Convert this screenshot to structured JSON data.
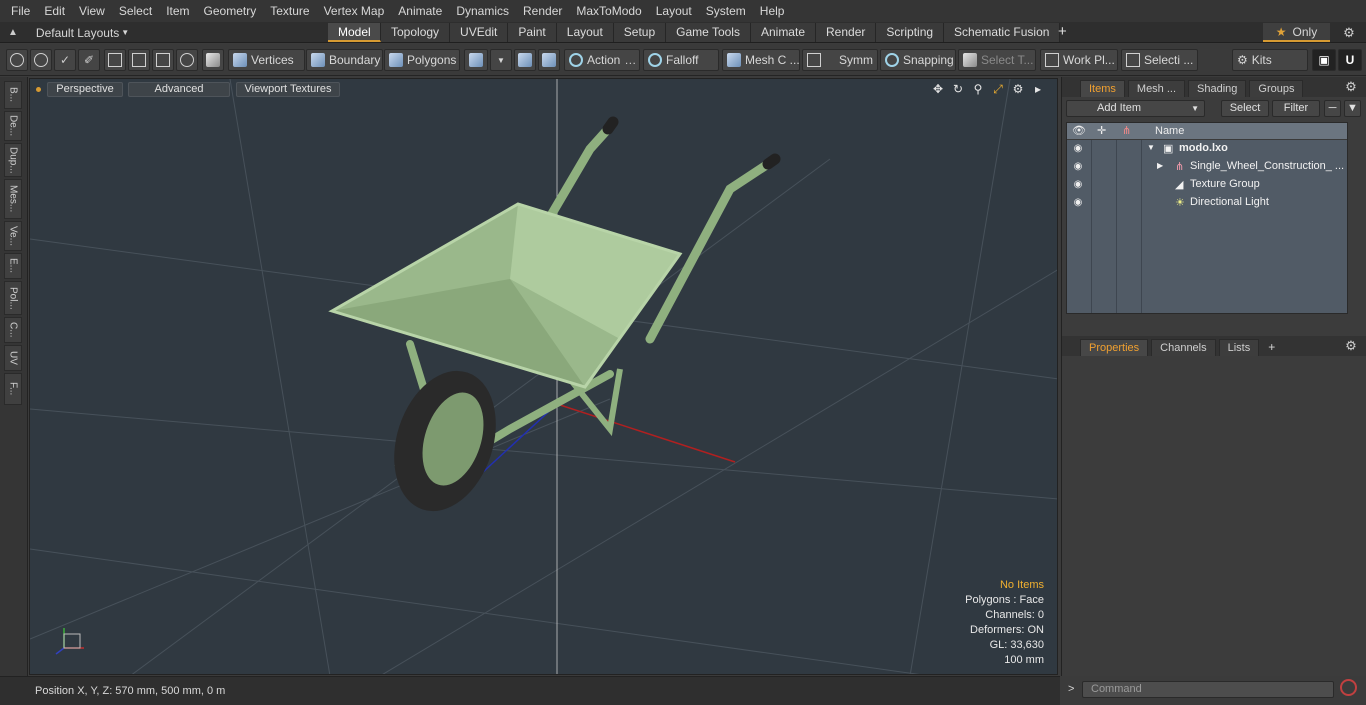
{
  "menu": [
    "File",
    "Edit",
    "View",
    "Select",
    "Item",
    "Geometry",
    "Texture",
    "Vertex Map",
    "Animate",
    "Dynamics",
    "Render",
    "MaxToModo",
    "Layout",
    "System",
    "Help"
  ],
  "layout_dropdown": "Default Layouts",
  "tabs": [
    "Model",
    "Topology",
    "UVEdit",
    "Paint",
    "Layout",
    "Setup",
    "Game Tools",
    "Animate",
    "Render",
    "Scripting",
    "Schematic Fusion"
  ],
  "active_tab": "Model",
  "only_label": "Only",
  "toolbar": {
    "vertices": "Vertices",
    "boundary": "Boundary",
    "polygons": "Polygons",
    "action": "Action",
    "falloff": "Falloff",
    "mesh": "Mesh C ...",
    "symm": "Symm ...",
    "snapping": "Snapping",
    "select_t": "Select T...",
    "work_pl": "Work Pl...",
    "selecti": "Selecti ...",
    "kits": "Kits"
  },
  "left_tabs": [
    "B...",
    "De...",
    "Dup...",
    "Mes...",
    "Ve...",
    "E...",
    "Pol...",
    "C...",
    "UV",
    "F..."
  ],
  "viewport": {
    "perspective": "Perspective",
    "advanced": "Advanced",
    "viewport_textures": "Viewport Textures",
    "hud": {
      "items": "No Items",
      "polygons": "Polygons : Face",
      "channels": "Channels: 0",
      "deformers": "Deformers: ON",
      "gl": "GL: 33,630",
      "scale": "100 mm"
    }
  },
  "status": "Position X, Y, Z:   570 mm, 500 mm, 0 m",
  "right_panel": {
    "tabs": [
      "Items",
      "Mesh ...",
      "Shading",
      "Groups"
    ],
    "active_tab": "Items",
    "add_item": "Add Item",
    "select": "Select",
    "filter": "Filter",
    "name_header": "Name",
    "items": [
      {
        "label": "modo.lxo",
        "bold": true
      },
      {
        "label": "Single_Wheel_Construction_ ..."
      },
      {
        "label": "Texture Group"
      },
      {
        "label": "Directional Light"
      }
    ],
    "bottom_tabs": [
      "Properties",
      "Channels",
      "Lists"
    ],
    "bottom_active": "Properties",
    "command_placeholder": "Command"
  }
}
